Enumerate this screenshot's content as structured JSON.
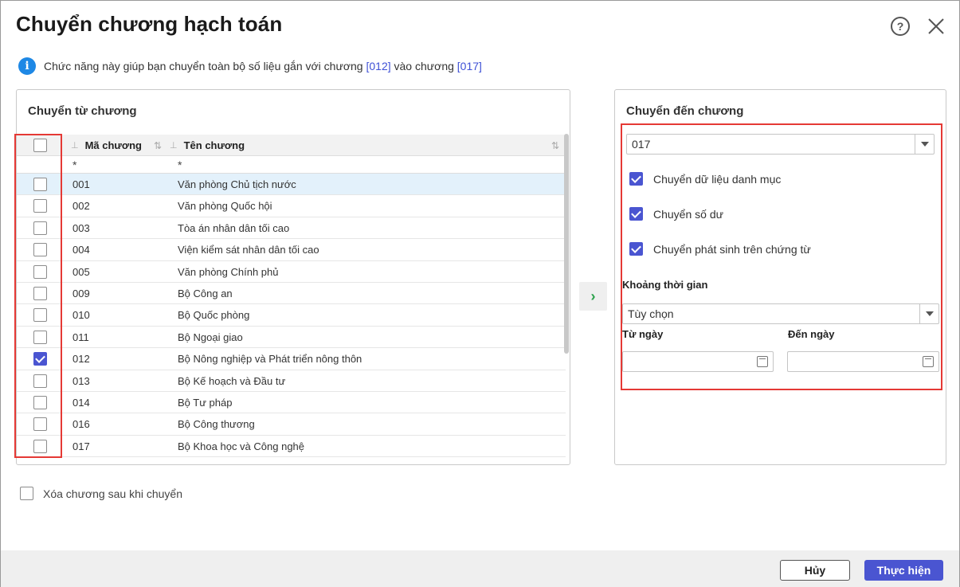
{
  "dialog": {
    "title": "Chuyển chương hạch toán",
    "help_symbol": "?",
    "info_prefix": "Chức năng này giúp bạn chuyển toàn bộ số liệu gắn với chương",
    "info_from_code": "[012]",
    "info_middle": "vào chương",
    "info_to_code": "[017]"
  },
  "from_panel": {
    "title": "Chuyển từ chương",
    "columns": {
      "code": "Mã chương",
      "name": "Tên chương"
    },
    "filter_code": "*",
    "filter_name": "*",
    "rows": [
      {
        "code": "001",
        "name": "Văn phòng Chủ tịch nước",
        "checked": false,
        "highlighted": true
      },
      {
        "code": "002",
        "name": "Văn phòng Quốc hội",
        "checked": false
      },
      {
        "code": "003",
        "name": "Tòa án nhân dân tối cao",
        "checked": false
      },
      {
        "code": "004",
        "name": "Viện kiểm sát nhân dân tối cao",
        "checked": false
      },
      {
        "code": "005",
        "name": "Văn phòng Chính phủ",
        "checked": false
      },
      {
        "code": "009",
        "name": "Bộ Công an",
        "checked": false
      },
      {
        "code": "010",
        "name": "Bộ Quốc phòng",
        "checked": false
      },
      {
        "code": "011",
        "name": "Bộ Ngoại giao",
        "checked": false
      },
      {
        "code": "012",
        "name": "Bộ Nông nghiệp và Phát triển nông thôn",
        "checked": true
      },
      {
        "code": "013",
        "name": "Bộ Kế hoạch và Đầu tư",
        "checked": false
      },
      {
        "code": "014",
        "name": "Bộ Tư pháp",
        "checked": false
      },
      {
        "code": "016",
        "name": "Bộ Công thương",
        "checked": false
      },
      {
        "code": "017",
        "name": "Bộ Khoa học và Công nghệ",
        "checked": false
      }
    ]
  },
  "to_panel": {
    "title": "Chuyển đến chương",
    "target_code": "017",
    "options": [
      {
        "label": "Chuyển dữ liệu danh mục",
        "checked": true
      },
      {
        "label": "Chuyển số dư",
        "checked": true
      },
      {
        "label": "Chuyển phát sinh trên chứng từ",
        "checked": true
      }
    ],
    "period_label": "Khoảng thời gian",
    "period_value": "Tùy chọn",
    "from_date_label": "Từ ngày",
    "to_date_label": "Đến ngày",
    "from_date_value": "",
    "to_date_value": ""
  },
  "delete_after": {
    "label": "Xóa chương sau khi chuyển",
    "checked": false
  },
  "footer": {
    "cancel_label": "Hủy",
    "ok_label": "Thực hiện"
  },
  "arrow_symbol": "›",
  "colors": {
    "accent": "#4a55d1",
    "highlight_box": "#e53935",
    "info": "#1e88e5",
    "arrow": "#2aa14a"
  }
}
